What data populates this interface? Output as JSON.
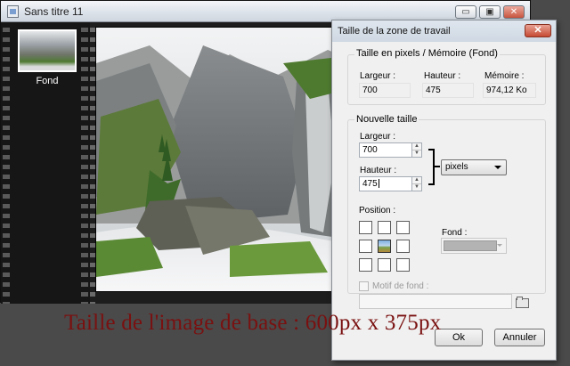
{
  "main_window": {
    "title": "Sans titre 11",
    "minimize_glyph": "▭",
    "maximize_glyph": "▣",
    "close_glyph": "✕",
    "thumbnail_label": "Fond"
  },
  "dialog": {
    "title": "Taille de la zone de travail",
    "close_glyph": "✕",
    "current": {
      "label": "Taille en pixels / Mémoire (Fond)",
      "width_label": "Largeur :",
      "width_value": "700",
      "height_label": "Hauteur :",
      "height_value": "475",
      "memory_label": "Mémoire :",
      "memory_value": "974,12 Ko"
    },
    "new_size": {
      "label": "Nouvelle taille",
      "width_label": "Largeur :",
      "width_value": "700",
      "height_label": "Hauteur :",
      "height_value": "475",
      "unit_selected": "pixels",
      "position_label": "Position :",
      "position_selected_index": 4,
      "fond_label": "Fond :",
      "fond_color": "#b3b3b3",
      "pattern_label": "Motif de fond :"
    },
    "ok_label": "Ok",
    "cancel_label": "Annuler"
  },
  "caption": "Taille de l'image de base : 600px x 375px",
  "colors": {
    "caption": "#7a1010",
    "dialog_bg": "#f0f0f0",
    "film_dark": "#161616"
  }
}
